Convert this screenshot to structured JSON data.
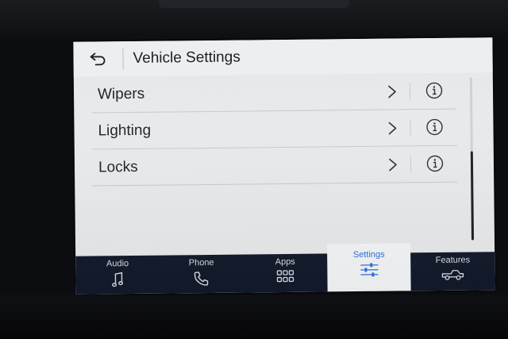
{
  "header": {
    "title": "Vehicle Settings",
    "back_icon": "back-arrow-icon"
  },
  "list": {
    "items": [
      {
        "label": "Wipers",
        "chevron_icon": "chevron-right-icon",
        "info_icon": "info-icon"
      },
      {
        "label": "Lighting",
        "chevron_icon": "chevron-right-icon",
        "info_icon": "info-icon"
      },
      {
        "label": "Locks",
        "chevron_icon": "chevron-right-icon",
        "info_icon": "info-icon"
      }
    ]
  },
  "tabbar": {
    "tabs": [
      {
        "label": "Audio",
        "icon": "music-note-icon",
        "active": false
      },
      {
        "label": "Phone",
        "icon": "phone-icon",
        "active": false
      },
      {
        "label": "Apps",
        "icon": "apps-grid-icon",
        "active": false
      },
      {
        "label": "Settings",
        "icon": "sliders-icon",
        "active": true
      },
      {
        "label": "Features",
        "icon": "pickup-truck-icon",
        "active": false
      }
    ]
  },
  "colors": {
    "screen_bg": "#e6e8ea",
    "tabbar_bg": "#121a2b",
    "active_tab_accent": "#2c6fdc"
  }
}
